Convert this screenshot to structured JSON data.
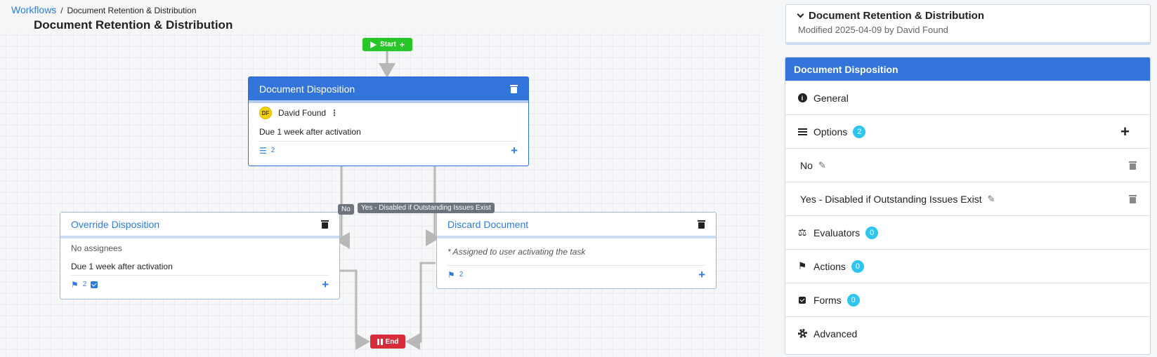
{
  "breadcrumb": {
    "root": "Workflows",
    "separator": "/",
    "current": "Document Retention & Distribution"
  },
  "page_title": "Document Retention & Distribution",
  "canvas": {
    "start_label": "Start",
    "end_label": "End",
    "edges": {
      "no": "No",
      "yes": "Yes - Disabled if Outstanding Issues Exist"
    },
    "nodes": {
      "disposition": {
        "title": "Document Disposition",
        "assignee_initials": "DF",
        "assignee_name": "David Found",
        "due": "Due 1 week after activation",
        "options_count": "2"
      },
      "override": {
        "title": "Override Disposition",
        "assignees": "No assignees",
        "due": "Due 1 week after activation",
        "flags_count": "2"
      },
      "discard": {
        "title": "Discard Document",
        "assignees": "* Assigned to user activating the task",
        "flags_count": "2"
      }
    }
  },
  "workflow_panel": {
    "title": "Document Retention & Distribution",
    "modified": "Modified 2025-04-09 by David Found"
  },
  "task_panel": {
    "title": "Document Disposition",
    "sections": {
      "general": "General",
      "options": "Options",
      "options_count": "2",
      "option_items": [
        "No",
        "Yes - Disabled if Outstanding Issues Exist"
      ],
      "evaluators": "Evaluators",
      "evaluators_count": "0",
      "actions": "Actions",
      "actions_count": "0",
      "forms": "Forms",
      "forms_count": "0",
      "advanced": "Advanced"
    }
  },
  "colors": {
    "accent": "#3374db",
    "start": "#28c728",
    "end": "#d92c3a",
    "badge": "#2ec5f0"
  },
  "icons": [
    "play-icon",
    "plus-icon",
    "trash-icon",
    "list-icon",
    "flag-icon",
    "check-icon",
    "info-icon",
    "scale-icon",
    "gear-icon",
    "pencil-icon",
    "pause-icon",
    "chevron-down-icon"
  ]
}
